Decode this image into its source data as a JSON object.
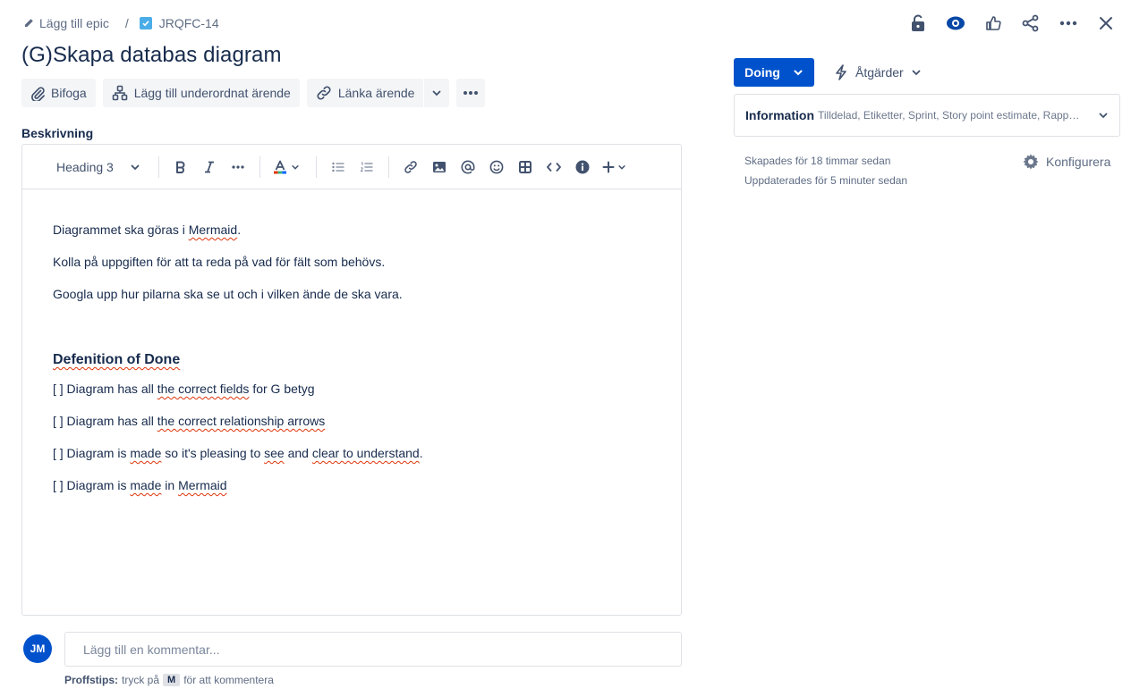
{
  "breadcrumb": {
    "epic_label": "Lägg till epic",
    "separator": "/",
    "issue_key": "JRQFC-14"
  },
  "issue": {
    "title": "(G)Skapa databas diagram"
  },
  "actions": {
    "attach": "Bifoga",
    "add_child": "Lägg till underordnat ärende",
    "link_issue": "Länka ärende"
  },
  "description": {
    "label": "Beskrivning",
    "toolbar": {
      "heading_select": "Heading 3"
    },
    "paragraphs": [
      {
        "pre": "Diagrammet ska göras i ",
        "sq": "Mermaid",
        "post": "."
      },
      {
        "text": "Kolla på uppgiften för att ta reda på vad för fält som behövs."
      },
      {
        "text": "Googla upp hur pilarna ska se ut och i vilken ände de ska vara."
      }
    ],
    "heading": "Defenition of Done",
    "checklist": [
      {
        "a": "[ ] Diagram has all ",
        "b": "the correct fields",
        "c": " for G betyg"
      },
      {
        "a": "[ ] Diagram has all ",
        "b": "the correct relationship arrows",
        "c": ""
      },
      {
        "a": "[ ] Diagram is ",
        "b": "made",
        "c": " so it's pleasing to ",
        "d": "see",
        "e": " and ",
        "f": "clear to understand",
        "g": "."
      },
      {
        "a": "[ ] Diagram is ",
        "b": "made",
        "c": " in ",
        "d": "Mermaid",
        "e": ""
      }
    ]
  },
  "comment": {
    "avatar_initials": "JM",
    "placeholder": "Lägg till en kommentar...",
    "protip_bold": "Proffstips:",
    "protip_pre": "tryck på",
    "protip_key": "M",
    "protip_post": "för att kommentera"
  },
  "sidebar": {
    "status": "Doing",
    "actions_label": "Åtgärder",
    "info_title": "Information",
    "info_summary": "Tilldelad, Etiketter, Sprint, Story point estimate, Rappor…",
    "created": "Skapades för 18 timmar sedan",
    "updated": "Uppdaterades för 5 minuter sedan",
    "configure": "Konfigurera"
  },
  "colors": {
    "primary": "#0052cc",
    "text": "#172b4d",
    "subtle": "#5e6c84",
    "spellcheck": "#de350b",
    "issue_type": "#4bade8"
  },
  "icons": [
    "pencil-icon",
    "checkbox-icon",
    "lock-icon",
    "watch-icon",
    "like-icon",
    "share-icon",
    "more-icon",
    "close-icon",
    "attach-icon",
    "child-issue-icon",
    "link-icon",
    "chevron-down-icon",
    "bold-icon",
    "italic-icon",
    "text-color-icon",
    "bullet-list-icon",
    "numbered-list-icon",
    "image-icon",
    "mention-icon",
    "emoji-icon",
    "table-icon",
    "code-icon",
    "info-icon",
    "plus-icon",
    "lightning-icon",
    "gear-icon"
  ]
}
